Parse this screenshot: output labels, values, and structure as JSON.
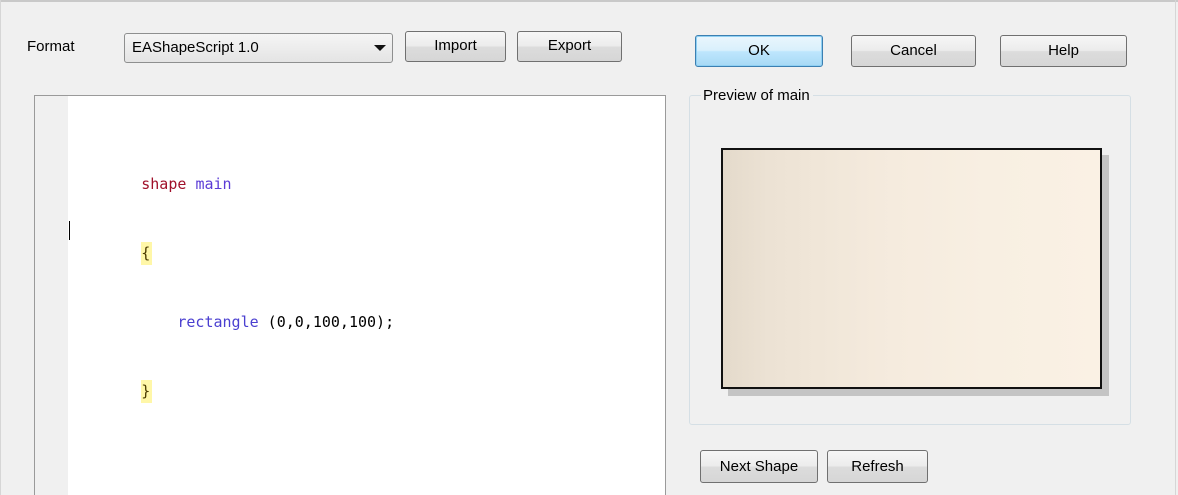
{
  "toolbar": {
    "format_label": "Format",
    "format_value": "EAShapeScript 1.0",
    "import_label": "Import",
    "export_label": "Export"
  },
  "dialog_buttons": {
    "ok_label": "OK",
    "cancel_label": "Cancel",
    "help_label": "Help"
  },
  "editor": {
    "lines": [
      {
        "keyword": "shape",
        "name": "main"
      },
      {
        "brace": "{"
      },
      {
        "indent": "    ",
        "function": "rectangle",
        "args": " (0,0,100,100);"
      },
      {
        "brace": "}"
      }
    ]
  },
  "preview": {
    "title": "Preview of main",
    "next_shape_label": "Next Shape",
    "refresh_label": "Refresh"
  },
  "colors": {
    "keyword": "#a0102a",
    "identifier": "#5b3cd6",
    "brace_highlight": "#fff7a8",
    "shape_fill_left": "#e4dacb",
    "shape_fill_right": "#faf1e4",
    "ok_button_accent": "#3c7fb1"
  }
}
